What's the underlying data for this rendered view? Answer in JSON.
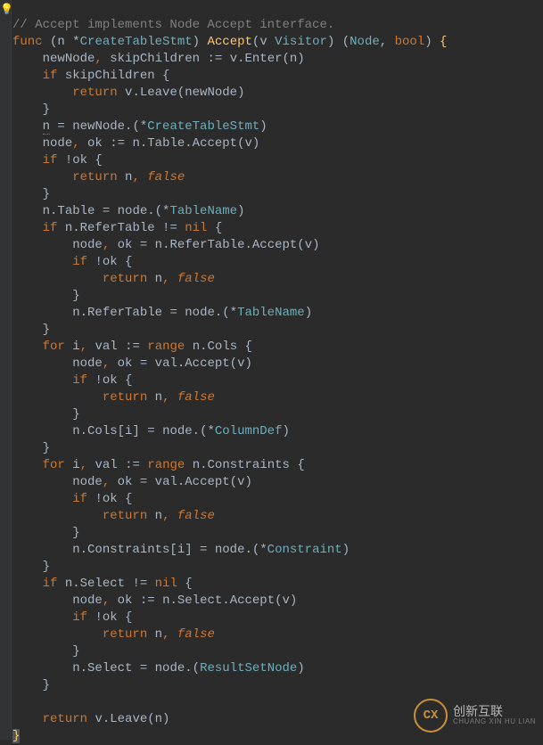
{
  "comment": "// Accept implements Node Accept interface.",
  "sig": {
    "kw_func": "func",
    "recv_n": "n",
    "recv_type": "CreateTableStmt",
    "method": "Accept",
    "param_v": "v",
    "param_type": "Visitor",
    "ret1": "Node",
    "ret2": "bool"
  },
  "l1": {
    "a": "newNode",
    "b": "skipChildren",
    "op": ":=",
    "call": "v.Enter(n)"
  },
  "l2": {
    "kw": "if",
    "cond": "skipChildren {"
  },
  "l3": {
    "kw": "return",
    "expr": "v.Leave(newNode)"
  },
  "l5": {
    "lhs": "n",
    "op": "=",
    "rhs": "newNode.(*",
    "type": "CreateTableStmt",
    "close": ")"
  },
  "l6": {
    "a": "node",
    "b": "ok",
    "op": ":=",
    "call": "n.Table.Accept(v)"
  },
  "l7": {
    "kw": "if",
    "cond": "!ok {"
  },
  "l8": {
    "kw": "return",
    "a": "n",
    "b": "false"
  },
  "l10": {
    "lhs": "n.Table",
    "op": "=",
    "rhs": "node.(*",
    "type": "TableName",
    "close": ")"
  },
  "l11": {
    "kw": "if",
    "cond": "n.ReferTable != ",
    "nil": "nil",
    "brace": " {"
  },
  "l12": {
    "a": "node",
    "b": "ok",
    "op": "=",
    "call": "n.ReferTable.Accept(v)"
  },
  "l13": {
    "kw": "if",
    "cond": "!ok {"
  },
  "l14": {
    "kw": "return",
    "a": "n",
    "b": "false"
  },
  "l16": {
    "lhs": "n.ReferTable",
    "op": "=",
    "rhs": "node.(*",
    "type": "TableName",
    "close": ")"
  },
  "l18": {
    "kw_for": "for",
    "i": "i",
    "val": "val",
    "op": ":=",
    "kw_range": "range",
    "expr": "n.Cols {"
  },
  "l19": {
    "a": "node",
    "b": "ok",
    "op": "=",
    "call": "val.Accept(v)"
  },
  "l20": {
    "kw": "if",
    "cond": "!ok {"
  },
  "l21": {
    "kw": "return",
    "a": "n",
    "b": "false"
  },
  "l23": {
    "lhs": "n.Cols[i]",
    "op": "=",
    "rhs": "node.(*",
    "type": "ColumnDef",
    "close": ")"
  },
  "l25": {
    "kw_for": "for",
    "i": "i",
    "val": "val",
    "op": ":=",
    "kw_range": "range",
    "expr": "n.Constraints {"
  },
  "l26": {
    "a": "node",
    "b": "ok",
    "op": "=",
    "call": "val.Accept(v)"
  },
  "l27": {
    "kw": "if",
    "cond": "!ok {"
  },
  "l28": {
    "kw": "return",
    "a": "n",
    "b": "false"
  },
  "l30": {
    "lhs": "n.Constraints[i]",
    "op": "=",
    "rhs": "node.(*",
    "type": "Constraint",
    "close": ")"
  },
  "l32": {
    "kw": "if",
    "cond": "n.Select != ",
    "nil": "nil",
    "brace": " {"
  },
  "l33": {
    "a": "node",
    "b": "ok",
    "op": ":=",
    "call": "n.Select.Accept(v)"
  },
  "l34": {
    "kw": "if",
    "cond": "!ok {"
  },
  "l35": {
    "kw": "return",
    "a": "n",
    "b": "false"
  },
  "l37": {
    "lhs": "n.Select",
    "op": "=",
    "rhs": "node.(",
    "type": "ResultSetNode",
    "close": ")"
  },
  "l40": {
    "kw": "return",
    "expr": "v.Leave(n)"
  },
  "watermark": {
    "logo": "CX",
    "cn": "创新互联",
    "en": "CHUANG XIN HU LIAN"
  }
}
